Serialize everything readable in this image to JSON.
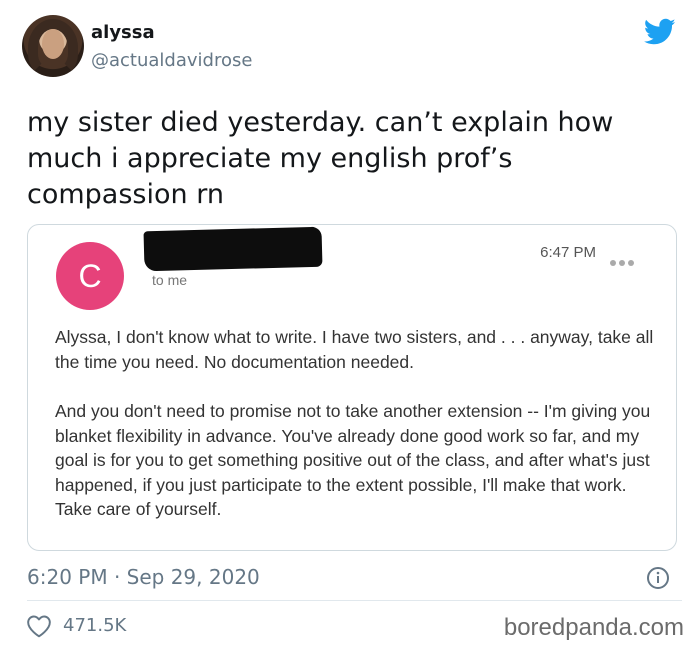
{
  "user": {
    "display_name": "alyssa",
    "handle": "@actualdavidrose"
  },
  "tweet": {
    "text": "my sister died yesterday. can’t explain how much i appreciate my english prof’s compassion rn",
    "timestamp": "6:20 PM · Sep 29, 2020",
    "likes": "471.5K"
  },
  "email": {
    "avatar_letter": "C",
    "recipient": "to me",
    "time": "6:47 PM",
    "paragraphs": [
      "Alyssa, I don't know what to write. I have two sisters, and . . . anyway, take all the time you need. No documentation needed.",
      "And you don't need to promise not to take another extension -- I'm giving you blanket flexibility in advance. You've already done good work so far, and my goal is for you to get something positive out of the class, and after what's just happened, if you just participate to the extent possible, I'll make that work. Take care of yourself."
    ]
  },
  "watermark": "boredpanda.com",
  "icons": {
    "bird": "twitter-bird-icon",
    "info": "info-icon",
    "like": "heart-icon",
    "more": "more-dots-icon"
  },
  "colors": {
    "twitter_blue": "#1da1f2",
    "email_avatar": "#e6427a",
    "secondary_text": "#657786"
  }
}
